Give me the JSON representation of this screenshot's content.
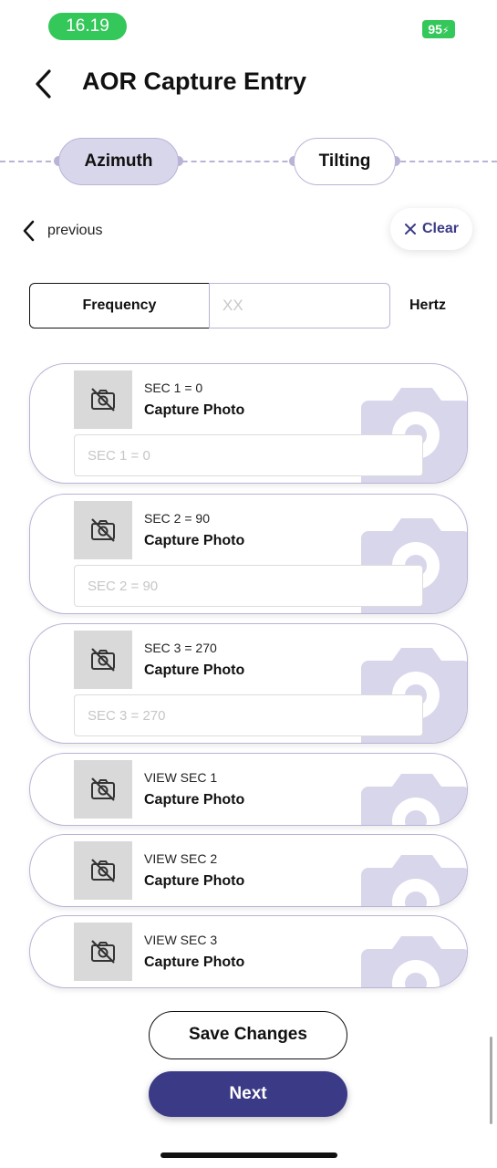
{
  "status_bar": {
    "time": "16.19",
    "battery": "95"
  },
  "header": {
    "title": "AOR Capture Entry"
  },
  "stepper": {
    "steps": [
      {
        "label": "Azimuth"
      },
      {
        "label": "Tilting"
      }
    ]
  },
  "nav": {
    "previous_label": "previous",
    "clear_label": "Clear"
  },
  "frequency": {
    "label": "Frequency",
    "value": "",
    "placeholder": "XX",
    "unit": "Hertz"
  },
  "cards": [
    {
      "sec_label": "SEC 1 = 0",
      "capture_label": "Capture Photo",
      "input_placeholder": "SEC 1 = 0"
    },
    {
      "sec_label": "SEC 2 = 90",
      "capture_label": "Capture Photo",
      "input_placeholder": "SEC 2 = 90"
    },
    {
      "sec_label": "SEC 3 = 270",
      "capture_label": "Capture Photo",
      "input_placeholder": "SEC 3 = 270"
    },
    {
      "sec_label": "VIEW SEC 1",
      "capture_label": "Capture Photo"
    },
    {
      "sec_label": "VIEW SEC 2",
      "capture_label": "Capture Photo"
    },
    {
      "sec_label": "VIEW SEC 3",
      "capture_label": "Capture Photo"
    }
  ],
  "actions": {
    "save_label": "Save Changes",
    "next_label": "Next"
  },
  "colors": {
    "accent": "#3b3a86",
    "step_active": "#d8d6ea",
    "border": "#b9b3d6",
    "status_green": "#34c759"
  },
  "icons": [
    "back-arrow-icon",
    "chevron-left-icon",
    "close-icon",
    "no-photo-icon",
    "camera-icon",
    "battery-icon"
  ]
}
